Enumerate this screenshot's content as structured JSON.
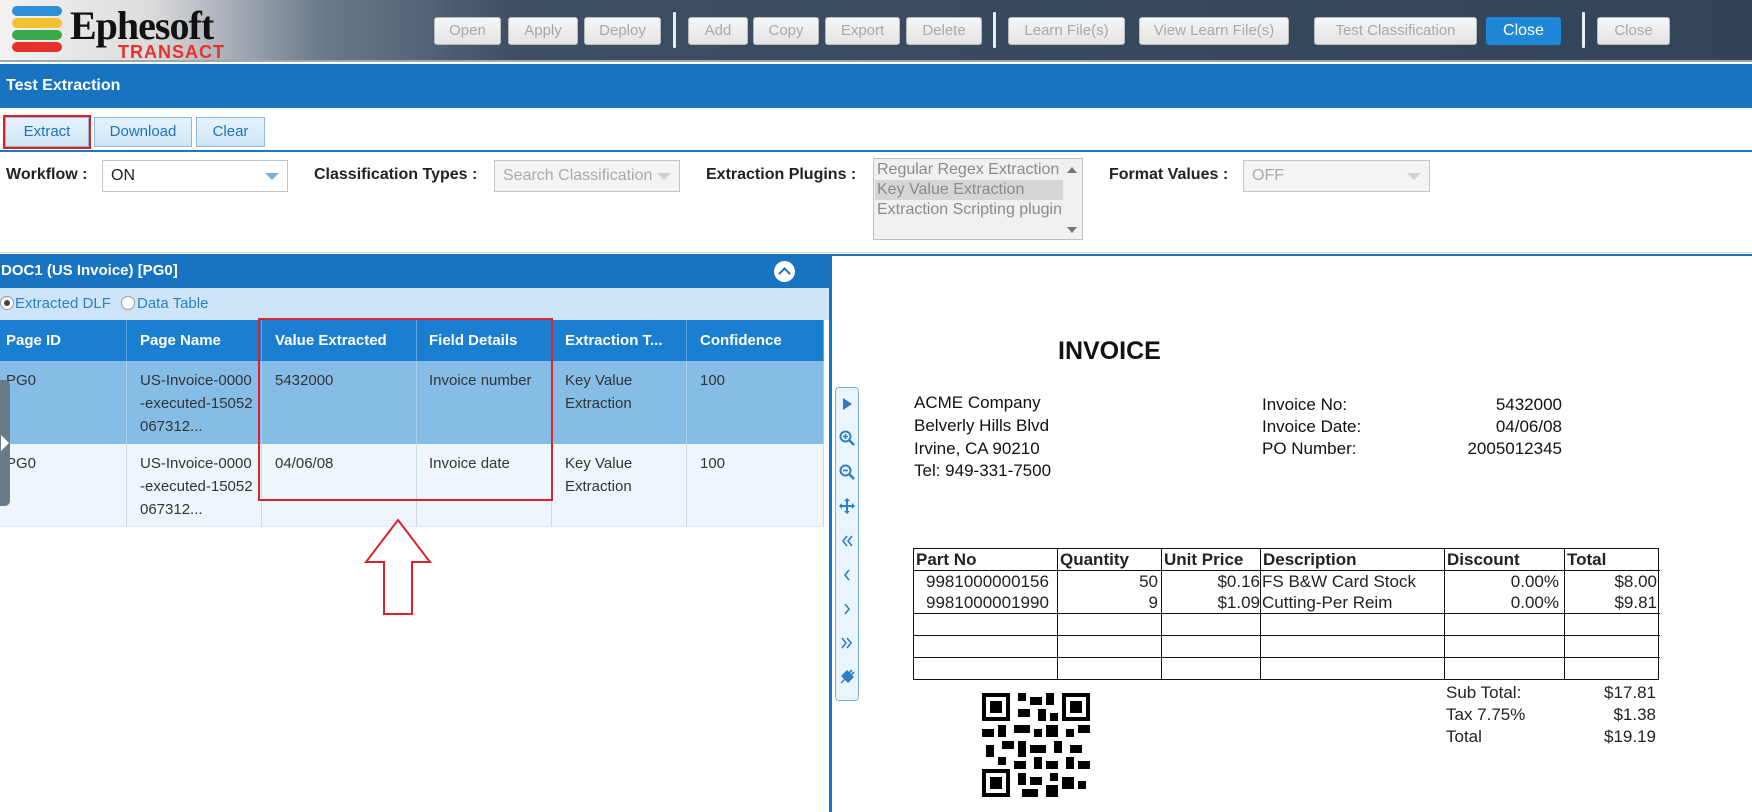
{
  "app": {
    "logo_name": "Ephesoft",
    "logo_sub": "TRANSACT",
    "logo_colors": [
      "#2c8fd8",
      "#f2c12e",
      "#3aa84a",
      "#e8312a"
    ]
  },
  "toolbar": {
    "buttons": [
      "Open",
      "Apply",
      "Deploy",
      "Add",
      "Copy",
      "Export",
      "Delete",
      "Learn File(s)",
      "View Learn File(s)",
      "Test Classification",
      "Close",
      "Close"
    ],
    "active_button": "Close"
  },
  "title": "Test Extraction",
  "actions": {
    "extract": "Extract",
    "download": "Download",
    "clear": "Clear"
  },
  "filters": {
    "workflow_label": "Workflow :",
    "workflow_value": "ON",
    "classification_label": "Classification Types :",
    "classification_placeholder": "Search Classification",
    "plugins_label": "Extraction Plugins :",
    "plugins": [
      "Regular Regex Extraction",
      "Key Value Extraction",
      "Extraction Scripting plugin"
    ],
    "plugins_selected": "Key Value Extraction",
    "format_label": "Format Values :",
    "format_value": "OFF"
  },
  "document": {
    "header": "DOC1 (US Invoice) [PG0]",
    "view_options": [
      "Extracted DLF",
      "Data Table"
    ],
    "selected_view": "Extracted DLF",
    "columns": [
      "Page ID",
      "Page Name",
      "Value Extracted",
      "Field Details",
      "Extraction T...",
      "Confidence"
    ],
    "rows": [
      {
        "page_id": "PG0",
        "page_name": "US-Invoice-0000-executed-15052067312...",
        "value": "5432000",
        "field": "Invoice number",
        "type": "Key Value Extraction",
        "confidence": "100"
      },
      {
        "page_id": "PG0",
        "page_name": "US-Invoice-0000-executed-15052067312...",
        "value": "04/06/08",
        "field": "Invoice date",
        "type": "Key Value Extraction",
        "confidence": "100"
      }
    ]
  },
  "viewer_tools": [
    "play-icon",
    "zoom-in-icon",
    "zoom-out-icon",
    "move-icon",
    "first-page-icon",
    "prev-page-icon",
    "next-page-icon",
    "last-page-icon",
    "plug-icon"
  ],
  "invoice": {
    "title": "INVOICE",
    "address": [
      "ACME Company",
      "Belverly Hills Blvd",
      "Irvine, CA 90210",
      "Tel: 949-331-7500"
    ],
    "meta": [
      {
        "k": "Invoice No:",
        "v": "5432000"
      },
      {
        "k": "Invoice Date:",
        "v": "04/06/08"
      },
      {
        "k": "PO Number:",
        "v": "2005012345"
      }
    ],
    "table_headers": [
      "Part No",
      "Quantity",
      "Unit Price",
      "Description",
      "Discount",
      "Total"
    ],
    "table_rows": [
      [
        "9981000000156",
        "50",
        "$0.16",
        "FS B&W Card Stock",
        "0.00%",
        "$8.00"
      ],
      [
        "9981000001990",
        "9",
        "$1.09",
        "Cutting-Per Reim",
        "0.00%",
        "$9.81"
      ]
    ],
    "totals": [
      {
        "k": "Sub Total:",
        "v": "$17.81"
      },
      {
        "k": "Tax 7.75%",
        "v": "$1.38"
      },
      {
        "k": "Total",
        "v": "$19.19"
      }
    ]
  }
}
